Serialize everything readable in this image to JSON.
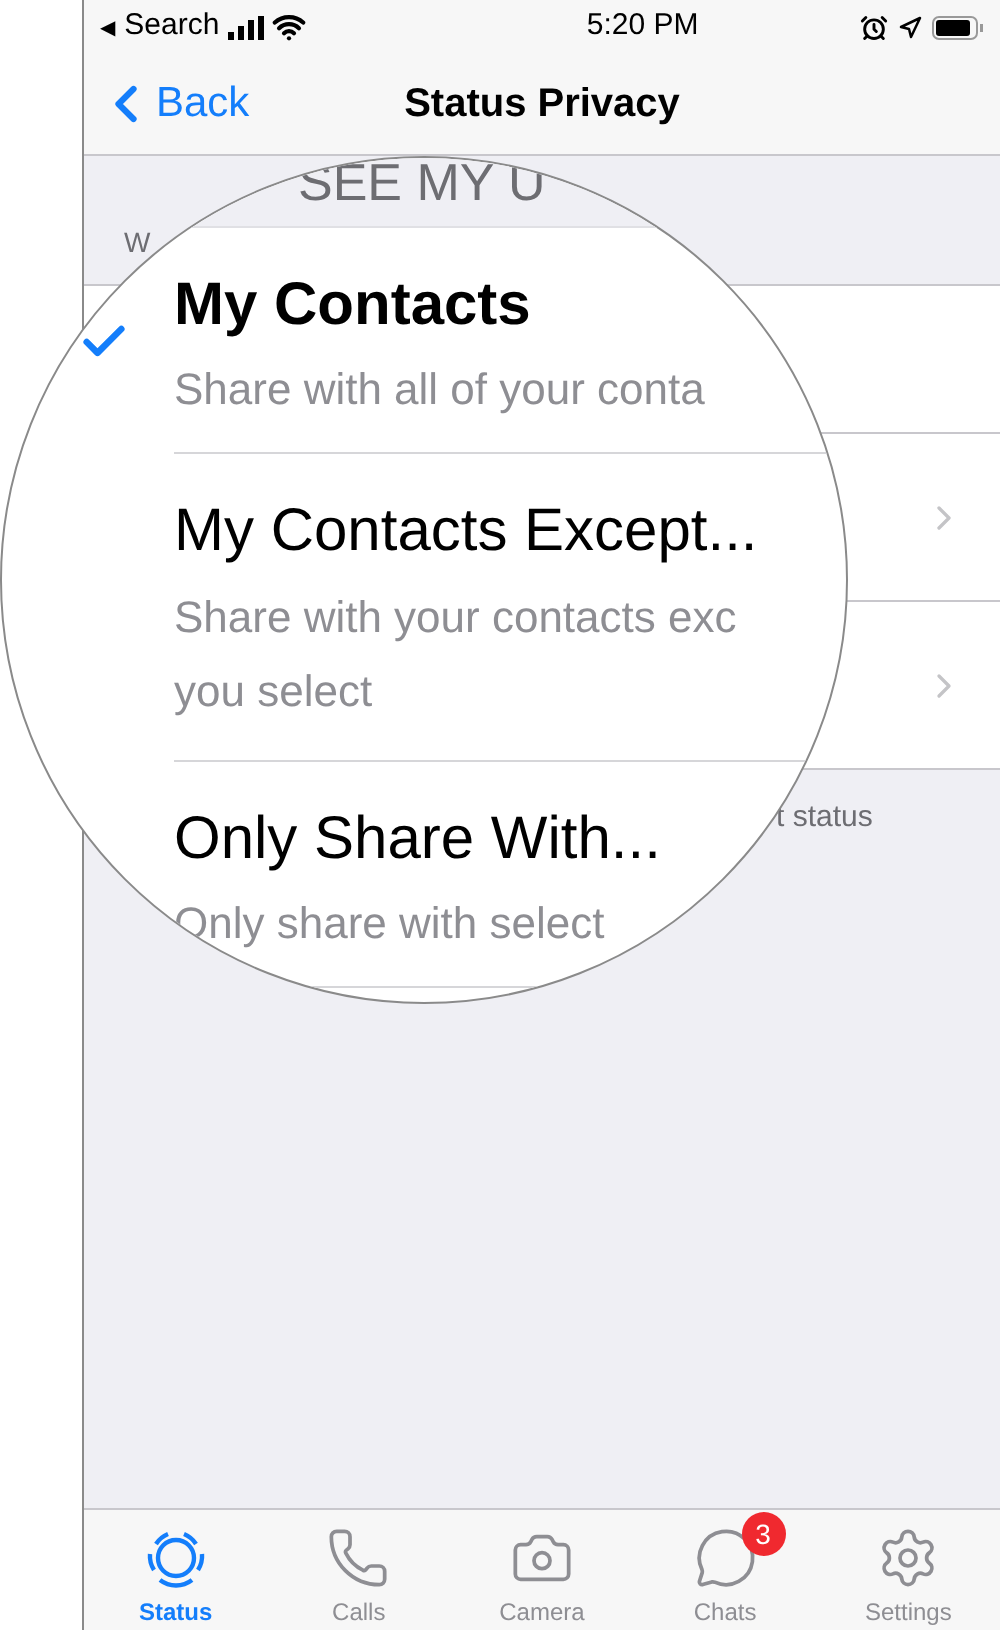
{
  "status_bar": {
    "back_glyph": "◀",
    "back_app": "Search",
    "time": "5:20 PM"
  },
  "nav": {
    "back": "Back",
    "title": "Status Privacy"
  },
  "section": {
    "header": "W",
    "footer": "t status",
    "rows": [
      {
        "chevron": false
      },
      {
        "chevron": true
      },
      {
        "chevron": true
      }
    ]
  },
  "magnifier": {
    "header": "SEE MY U",
    "options": [
      {
        "title": "My Contacts",
        "subtitle_lines": [
          "Share with all of your conta"
        ],
        "selected": true
      },
      {
        "title": "My Contacts Except...",
        "subtitle_lines": [
          "Share with your contacts exc",
          "you select"
        ],
        "selected": false
      },
      {
        "title": "Only Share With...",
        "subtitle_lines": [
          "Only share with select"
        ],
        "selected": false
      }
    ]
  },
  "tabs": [
    {
      "label": "Status",
      "kind": "status",
      "selected": true
    },
    {
      "label": "Calls",
      "kind": "calls",
      "selected": false
    },
    {
      "label": "Camera",
      "kind": "camera",
      "selected": false
    },
    {
      "label": "Chats",
      "kind": "chats",
      "selected": false,
      "badge": "3"
    },
    {
      "label": "Settings",
      "kind": "settings",
      "selected": false
    }
  ]
}
